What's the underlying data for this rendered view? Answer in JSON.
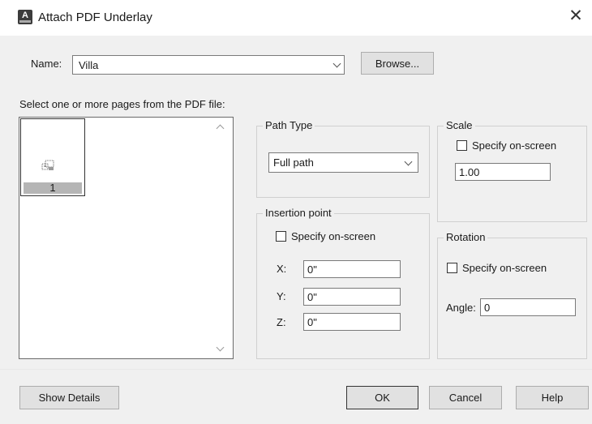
{
  "window": {
    "title": "Attach PDF Underlay",
    "app_icon_letter": "A",
    "close_glyph": "✕"
  },
  "name_row": {
    "label": "Name:",
    "value": "Villa",
    "browse_label": "Browse..."
  },
  "pages": {
    "instruction": "Select one or more pages from the PDF file:",
    "items": [
      {
        "label": "1"
      }
    ]
  },
  "path_type": {
    "group_label": "Path Type",
    "selected": "Full path"
  },
  "insertion_point": {
    "group_label": "Insertion point",
    "specify_label": "Specify on-screen",
    "specify_checked": false,
    "x_label": "X:",
    "x_value": "0\"",
    "y_label": "Y:",
    "y_value": "0\"",
    "z_label": "Z:",
    "z_value": "0\""
  },
  "scale": {
    "group_label": "Scale",
    "specify_label": "Specify on-screen",
    "specify_checked": false,
    "value": "1.00"
  },
  "rotation": {
    "group_label": "Rotation",
    "specify_label": "Specify on-screen",
    "specify_checked": false,
    "angle_label": "Angle:",
    "angle_value": "0"
  },
  "buttons": {
    "show_details": "Show Details",
    "ok": "OK",
    "cancel": "Cancel",
    "help": "Help"
  }
}
